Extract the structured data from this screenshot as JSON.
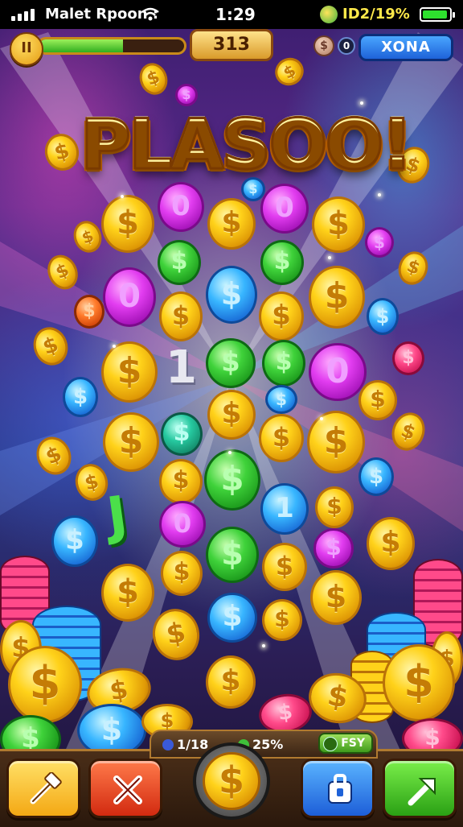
{
  "status_bar": {
    "carrier": "Malet Rpoon :",
    "time": "1:29",
    "battery_text": "ID2/19%"
  },
  "hud": {
    "pause_label": "II",
    "progress_fraction": 0.58,
    "score": "313",
    "token_count": "0",
    "bonus_label": "XONA"
  },
  "title": "PLASOO!",
  "board": {
    "coin_symbol": "$",
    "alt_symbol": "0",
    "number_one": "1",
    "letter_j": "J"
  },
  "bottom_stats": {
    "stat1": "1/18",
    "stat2": "25%",
    "fsy_label": "FSY"
  },
  "center_button_symbol": "$",
  "colors": {
    "gold": "#ffd21a",
    "purple": "#e23df0",
    "green": "#3fd23a",
    "blue": "#38b6ff",
    "accent_bonus": "#1e62d8"
  },
  "icons": {
    "tool1": "hammer-icon",
    "tool2": "cross-icon",
    "tool3": "shield-icon",
    "tool4": "arrow-icon"
  }
}
